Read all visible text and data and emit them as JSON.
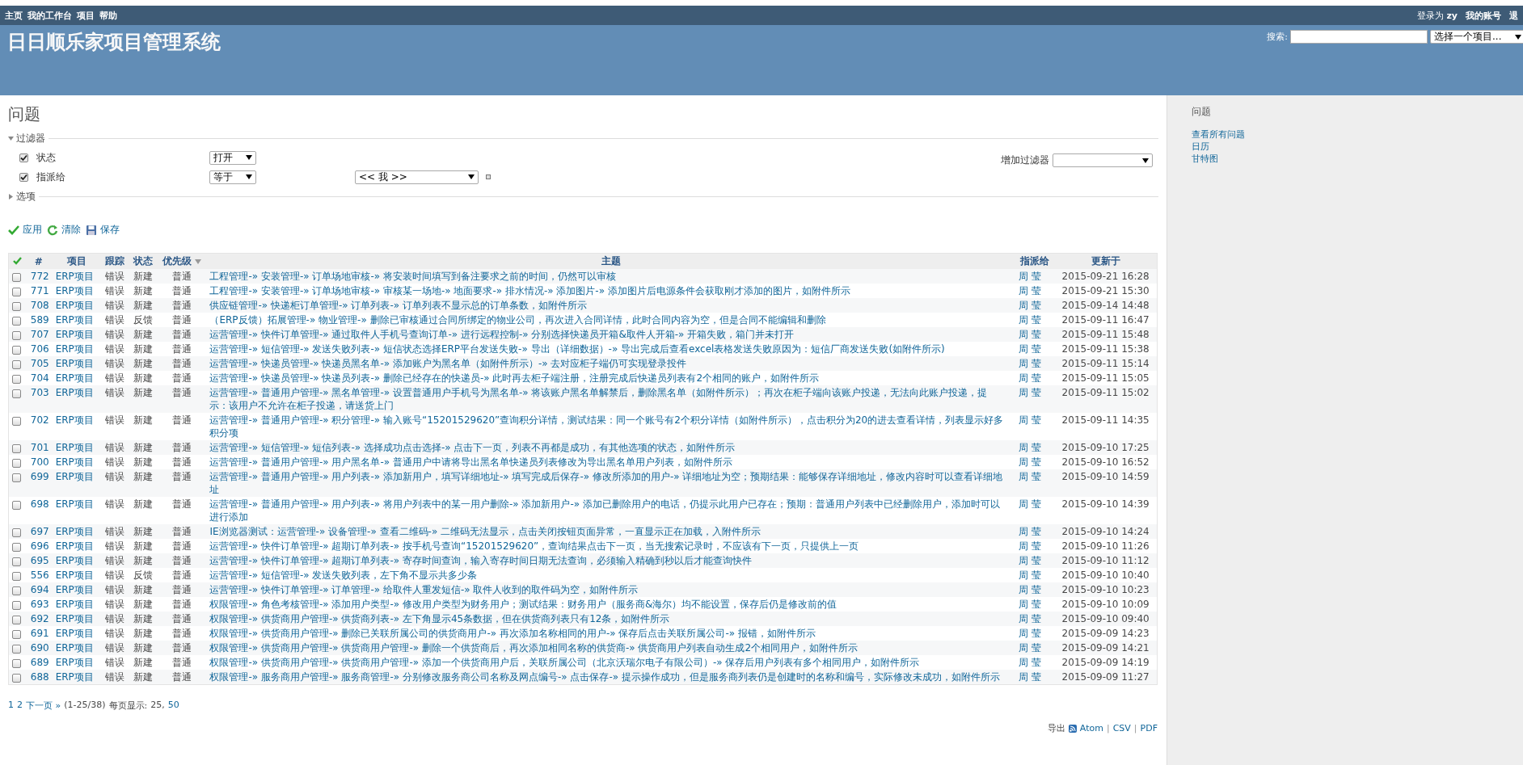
{
  "top_menu": {
    "items": [
      "主页",
      "我的工作台",
      "项目",
      "帮助"
    ],
    "logged_in_label": "登录为",
    "user": "zy",
    "links": [
      "我的账号",
      "退"
    ]
  },
  "header": {
    "title": "日日顺乐家项目管理系统",
    "search_label": "搜索:",
    "project_select": "选择一个项目..."
  },
  "page_title": "问题",
  "filters": {
    "legend": "过滤器",
    "expanded": true,
    "add_label": "增加过滤器",
    "rows": [
      {
        "label": "状态",
        "checked": true,
        "operator": "打开"
      },
      {
        "label": "指派给",
        "checked": true,
        "operator": "等于",
        "value": "<< 我 >>"
      }
    ]
  },
  "options": {
    "legend": "选项",
    "expanded": false
  },
  "actions": [
    {
      "label": "应用",
      "kind": "apply"
    },
    {
      "label": "清除",
      "kind": "clear"
    },
    {
      "label": "保存",
      "kind": "save"
    }
  ],
  "table": {
    "columns": [
      {
        "label": "#",
        "sorted": false
      },
      {
        "label": "项目",
        "sorted": false
      },
      {
        "label": "跟踪",
        "sorted": false
      },
      {
        "label": "状态",
        "sorted": false
      },
      {
        "label": "优先级",
        "sorted": true
      },
      {
        "label": "主题",
        "sorted": false
      },
      {
        "label": "指派给",
        "sorted": false
      },
      {
        "label": "更新于",
        "sorted": false
      }
    ],
    "rows": [
      {
        "checked": false,
        "id": "772",
        "project": "ERP项目",
        "tracker": "错误",
        "status": "新建",
        "priority": "普通",
        "subject": "工程管理-» 安装管理-» 订单场地审核-» 将安装时间填写到备注要求之前的时间，仍然可以审核",
        "assignee": "周 莹",
        "updated": "2015-09-21 16:28"
      },
      {
        "checked": false,
        "id": "771",
        "project": "ERP项目",
        "tracker": "错误",
        "status": "新建",
        "priority": "普通",
        "subject": "工程管理-» 安装管理-» 订单场地审核-» 审核某一场地-» 地面要求-» 排水情况-» 添加图片-» 添加图片后电源条件会获取刚才添加的图片，如附件所示",
        "assignee": "周 莹",
        "updated": "2015-09-21 15:30"
      },
      {
        "checked": false,
        "id": "708",
        "project": "ERP项目",
        "tracker": "错误",
        "status": "新建",
        "priority": "普通",
        "subject": "供应链管理-» 快递柜订单管理-» 订单列表-» 订单列表不显示总的订单条数，如附件所示",
        "assignee": "周 莹",
        "updated": "2015-09-14 14:48"
      },
      {
        "checked": false,
        "id": "589",
        "project": "ERP项目",
        "tracker": "错误",
        "status": "反馈",
        "priority": "普通",
        "subject": "（ERP反馈）拓展管理-» 物业管理-» 删除已审核通过合同所绑定的物业公司，再次进入合同详情，此时合同内容为空，但是合同不能编辑和删除",
        "assignee": "周 莹",
        "updated": "2015-09-11 16:47"
      },
      {
        "checked": false,
        "id": "707",
        "project": "ERP项目",
        "tracker": "错误",
        "status": "新建",
        "priority": "普通",
        "subject": "运营管理-» 快件订单管理-» 通过取件人手机号查询订单-» 进行远程控制-» 分别选择快递员开箱&取件人开箱-» 开箱失败，箱门并未打开",
        "assignee": "周 莹",
        "updated": "2015-09-11 15:48"
      },
      {
        "checked": false,
        "id": "706",
        "project": "ERP项目",
        "tracker": "错误",
        "status": "新建",
        "priority": "普通",
        "subject": "运营管理-» 短信管理-» 发送失败列表-» 短信状态选择ERP平台发送失败-» 导出（详细数据）-» 导出完成后查看excel表格发送失败原因为：短信厂商发送失败(如附件所示)",
        "assignee": "周 莹",
        "updated": "2015-09-11 15:38"
      },
      {
        "checked": false,
        "id": "705",
        "project": "ERP项目",
        "tracker": "错误",
        "status": "新建",
        "priority": "普通",
        "subject": "运营管理-» 快递员管理-» 快递员黑名单-» 添加账户为黑名单（如附件所示）-» 去对应柜子端仍可实现登录投件",
        "assignee": "周 莹",
        "updated": "2015-09-11 15:14"
      },
      {
        "checked": false,
        "id": "704",
        "project": "ERP项目",
        "tracker": "错误",
        "status": "新建",
        "priority": "普通",
        "subject": "运营管理-» 快递员管理-» 快递员列表-» 删除已经存在的快递员-» 此时再去柜子端注册，注册完成后快递员列表有2个相同的账户，如附件所示",
        "assignee": "周 莹",
        "updated": "2015-09-11 15:05"
      },
      {
        "checked": false,
        "id": "703",
        "project": "ERP项目",
        "tracker": "错误",
        "status": "新建",
        "priority": "普通",
        "subject": "运营管理-» 普通用户管理-» 黑名单管理-» 设置普通用户手机号为黑名单-» 将该账户黑名单解禁后，删除黑名单（如附件所示）；再次在柜子端向该账户投递，无法向此账户投递，提示：该用户不允许在柜子投递，请送货上门",
        "assignee": "周 莹",
        "updated": "2015-09-11 15:02"
      },
      {
        "checked": false,
        "id": "702",
        "project": "ERP项目",
        "tracker": "错误",
        "status": "新建",
        "priority": "普通",
        "subject": "运营管理-» 普通用户管理-» 积分管理-» 输入账号“15201529620”查询积分详情，测试结果：同一个账号有2个积分详情（如附件所示），点击积分为20的进去查看详情，列表显示好多积分项",
        "assignee": "周 莹",
        "updated": "2015-09-11 14:35"
      },
      {
        "checked": false,
        "id": "701",
        "project": "ERP项目",
        "tracker": "错误",
        "status": "新建",
        "priority": "普通",
        "subject": "运营管理-» 短信管理-» 短信列表-» 选择成功点击选择-» 点击下一页，列表不再都是成功，有其他选项的状态，如附件所示",
        "assignee": "周 莹",
        "updated": "2015-09-10 17:25"
      },
      {
        "checked": false,
        "id": "700",
        "project": "ERP项目",
        "tracker": "错误",
        "status": "新建",
        "priority": "普通",
        "subject": "运营管理-» 普通用户管理-» 用户黑名单-» 普通用户中请将导出黑名单快递员列表修改为导出黑名单用户列表，如附件所示",
        "assignee": "周 莹",
        "updated": "2015-09-10 16:52"
      },
      {
        "checked": false,
        "id": "699",
        "project": "ERP项目",
        "tracker": "错误",
        "status": "新建",
        "priority": "普通",
        "subject": "运营管理-» 普通用户管理-» 用户列表-» 添加新用户，填写详细地址-» 填写完成后保存-» 修改所添加的用户-» 详细地址为空；预期结果：能够保存详细地址，修改内容时可以查看详细地址",
        "assignee": "周 莹",
        "updated": "2015-09-10 14:59"
      },
      {
        "checked": false,
        "id": "698",
        "project": "ERP项目",
        "tracker": "错误",
        "status": "新建",
        "priority": "普通",
        "subject": "运营管理-» 普通用户管理-» 用户列表-» 将用户列表中的某一用户删除-» 添加新用户-» 添加已删除用户的电话，仍提示此用户已存在；预期：普通用户列表中已经删除用户，添加时可以进行添加",
        "assignee": "周 莹",
        "updated": "2015-09-10 14:39"
      },
      {
        "checked": false,
        "id": "697",
        "project": "ERP项目",
        "tracker": "错误",
        "status": "新建",
        "priority": "普通",
        "subject": "IE浏览器测试：运营管理-» 设备管理-» 查看二维码-» 二维码无法显示，点击关闭按钮页面异常，一直显示正在加载，入附件所示",
        "assignee": "周 莹",
        "updated": "2015-09-10 14:24"
      },
      {
        "checked": false,
        "id": "696",
        "project": "ERP项目",
        "tracker": "错误",
        "status": "新建",
        "priority": "普通",
        "subject": "运营管理-» 快件订单管理-» 超期订单列表-» 按手机号查询“15201529620”，查询结果点击下一页，当无搜索记录时，不应该有下一页，只提供上一页",
        "assignee": "周 莹",
        "updated": "2015-09-10 11:26"
      },
      {
        "checked": false,
        "id": "695",
        "project": "ERP项目",
        "tracker": "错误",
        "status": "新建",
        "priority": "普通",
        "subject": "运营管理-» 快件订单管理-» 超期订单列表-» 寄存时间查询，输入寄存时间日期无法查询，必须输入精确到秒以后才能查询快件",
        "assignee": "周 莹",
        "updated": "2015-09-10 11:12"
      },
      {
        "checked": false,
        "id": "556",
        "project": "ERP项目",
        "tracker": "错误",
        "status": "反馈",
        "priority": "普通",
        "subject": "运营管理-» 短信管理-» 发送失败列表，左下角不显示共多少条",
        "assignee": "周 莹",
        "updated": "2015-09-10 10:40"
      },
      {
        "checked": false,
        "id": "694",
        "project": "ERP项目",
        "tracker": "错误",
        "status": "新建",
        "priority": "普通",
        "subject": "运营管理-» 快件订单管理-» 订单管理-» 给取件人重发短信-» 取件人收到的取件码为空，如附件所示",
        "assignee": "周 莹",
        "updated": "2015-09-10 10:23"
      },
      {
        "checked": false,
        "id": "693",
        "project": "ERP项目",
        "tracker": "错误",
        "status": "新建",
        "priority": "普通",
        "subject": "权限管理-» 角色考核管理-» 添加用户类型-» 修改用户类型为财务用户；测试结果：财务用户（服务商&海尔）均不能设置，保存后仍是修改前的值",
        "assignee": "周 莹",
        "updated": "2015-09-10 10:09"
      },
      {
        "checked": false,
        "id": "692",
        "project": "ERP项目",
        "tracker": "错误",
        "status": "新建",
        "priority": "普通",
        "subject": "权限管理-» 供货商用户管理-» 供货商列表-» 左下角显示45条数据，但在供货商列表只有12条，如附件所示",
        "assignee": "周 莹",
        "updated": "2015-09-10 09:40"
      },
      {
        "checked": false,
        "id": "691",
        "project": "ERP项目",
        "tracker": "错误",
        "status": "新建",
        "priority": "普通",
        "subject": "权限管理-» 供货商用户管理-» 删除已关联所属公司的供货商用户-» 再次添加名称相同的用户-» 保存后点击关联所属公司-» 报错，如附件所示",
        "assignee": "周 莹",
        "updated": "2015-09-09 14:23"
      },
      {
        "checked": false,
        "id": "690",
        "project": "ERP项目",
        "tracker": "错误",
        "status": "新建",
        "priority": "普通",
        "subject": "权限管理-» 供货商用户管理-» 供货商用户管理-» 删除一个供货商后，再次添加相同名称的供货商-» 供货商用户列表自动生成2个相同用户，如附件所示",
        "assignee": "周 莹",
        "updated": "2015-09-09 14:21"
      },
      {
        "checked": false,
        "id": "689",
        "project": "ERP项目",
        "tracker": "错误",
        "status": "新建",
        "priority": "普通",
        "subject": "权限管理-» 供货商用户管理-» 供货商用户管理-» 添加一个供货商用户后，关联所属公司（北京沃瑞尔电子有限公司）-» 保存后用户列表有多个相同用户，如附件所示",
        "assignee": "周 莹",
        "updated": "2015-09-09 14:19"
      },
      {
        "checked": false,
        "id": "688",
        "project": "ERP项目",
        "tracker": "错误",
        "status": "新建",
        "priority": "普通",
        "subject": "权限管理-» 服务商用户管理-» 服务商管理-» 分别修改服务商公司名称及网点编号-» 点击保存-» 提示操作成功，但是服务商列表仍是创建时的名称和编号，实际修改未成功，如附件所示",
        "assignee": "周 莹",
        "updated": "2015-09-09 11:27"
      }
    ]
  },
  "pagination": {
    "pages": [
      "1",
      "2"
    ],
    "next": "下一页 »",
    "range": "(1-25/38)",
    "per_page_label": "每页显示:",
    "separator": ",",
    "per_page": [
      {
        "label": "25",
        "selected": true
      },
      {
        "label": "50",
        "selected": false
      }
    ]
  },
  "export": {
    "label": "导出",
    "formats": [
      "Atom",
      "CSV",
      "PDF"
    ],
    "separator": "|"
  },
  "sidebar": {
    "title": "问题",
    "links": [
      "查看所有问题",
      "日历",
      "甘特图"
    ]
  }
}
